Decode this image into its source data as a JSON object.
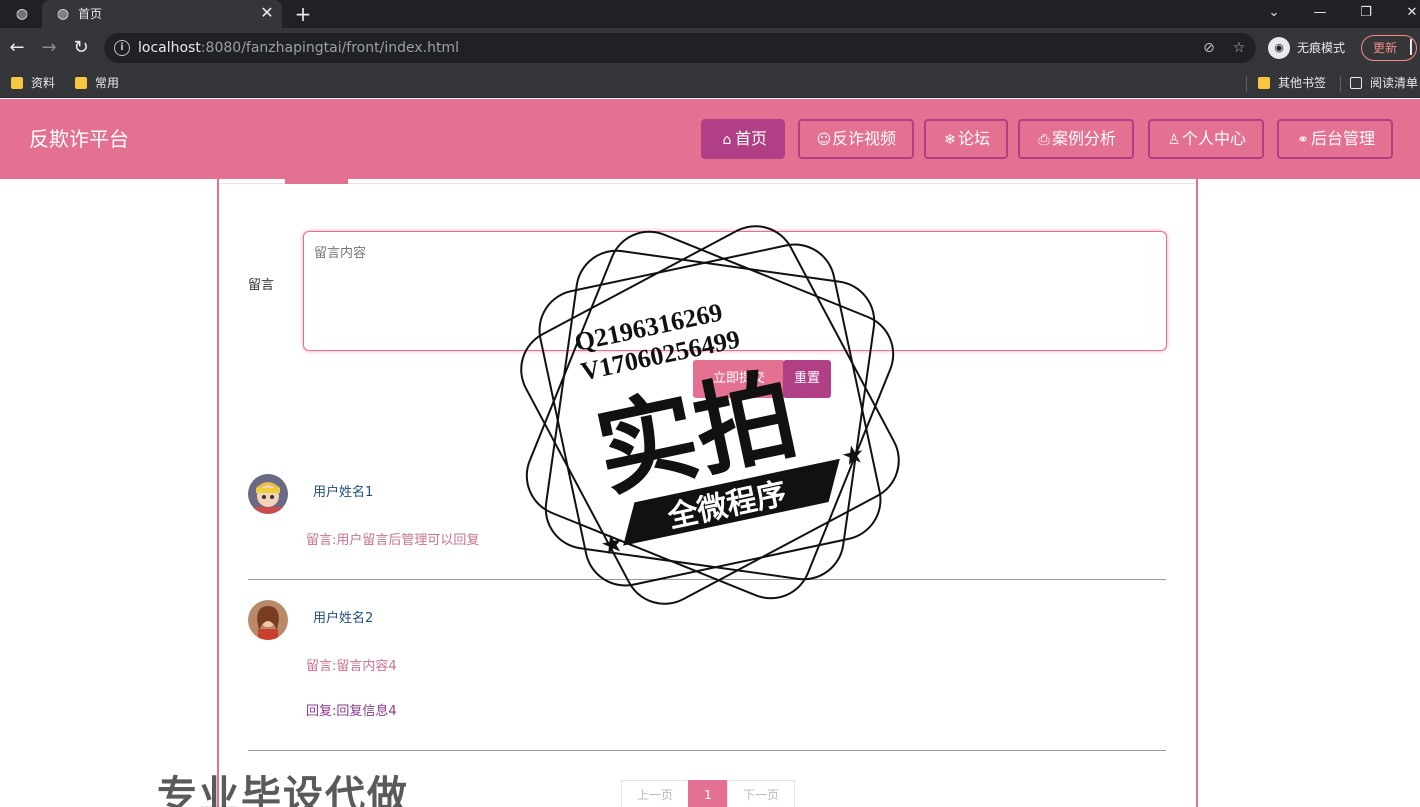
{
  "browser": {
    "tab_title": "首页",
    "url_host": "localhost",
    "url_rest": ":8080/fanzhapingtai/front/index.html",
    "incognito_label": "无痕模式",
    "update_label": "更新",
    "bookmarks": [
      "资料",
      "常用"
    ],
    "other_bookmarks": "其他书签",
    "reading_list": "阅读清单"
  },
  "header": {
    "brand": "反欺诈平台",
    "nav": [
      {
        "label": "首页",
        "icon": "home-icon"
      },
      {
        "label": "反诈视频",
        "icon": "video-icon"
      },
      {
        "label": "论坛",
        "icon": "snowflake-icon"
      },
      {
        "label": "案例分析",
        "icon": "printer-icon"
      },
      {
        "label": "个人中心",
        "icon": "user-icon"
      },
      {
        "label": "后台管理",
        "icon": "link-icon"
      }
    ]
  },
  "form": {
    "label": "留言",
    "placeholder": "留言内容",
    "submit_label": "立即提交",
    "reset_label": "重置"
  },
  "comments": [
    {
      "name": "用户姓名1",
      "message": "留言:用户留言后管理可以回复",
      "reply": ""
    },
    {
      "name": "用户姓名2",
      "message": "留言:留言内容4",
      "reply": "回复:回复信息4"
    }
  ],
  "pager": {
    "prev": "上一页",
    "current": "1",
    "next": "下一页"
  },
  "watermark": {
    "line1": "Q2196316269",
    "line2": "V17060256499",
    "big": "实拍",
    "banner": "全微程序"
  },
  "ad_text": "专业毕设代做",
  "colors": {
    "header_bg": "#e47192",
    "accent_dark": "#b03f85"
  }
}
